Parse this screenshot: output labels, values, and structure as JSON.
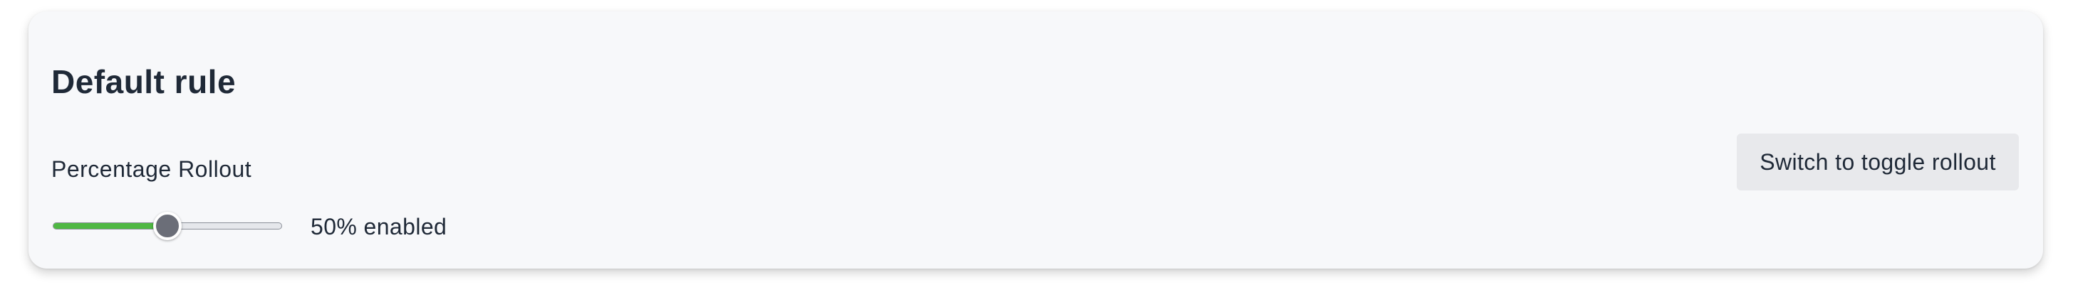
{
  "card": {
    "title": "Default rule",
    "rollout": {
      "label": "Percentage Rollout",
      "percent": 50,
      "value_text": "50% enabled"
    },
    "switch_button_label": "Switch to toggle rollout"
  },
  "colors": {
    "accent_fill": "#4fb843",
    "thumb": "#6b6e78",
    "card_background": "#f7f8fa",
    "text": "#1f2937"
  }
}
